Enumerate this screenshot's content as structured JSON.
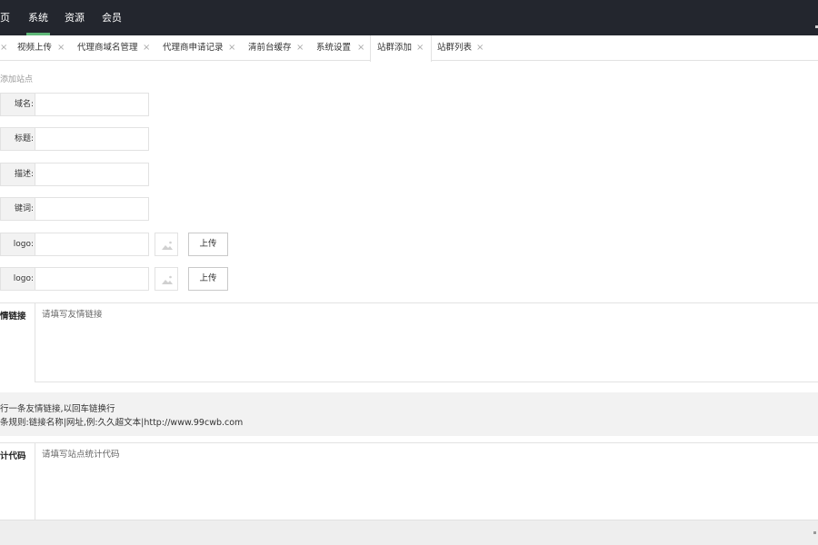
{
  "topnav": {
    "items": [
      {
        "label": "页",
        "active": false
      },
      {
        "label": "系统",
        "active": true
      },
      {
        "label": "资源",
        "active": false
      },
      {
        "label": "会员",
        "active": false
      }
    ],
    "active_color": "#5fb878",
    "background": "#23262e"
  },
  "tabs": [
    {
      "label": "视频上传",
      "active": false
    },
    {
      "label": "代理商域名管理",
      "active": false
    },
    {
      "label": "代理商申请记录",
      "active": false
    },
    {
      "label": "清前台缓存",
      "active": false
    },
    {
      "label": "系统设置",
      "active": false
    },
    {
      "label": "站群添加",
      "active": true
    },
    {
      "label": "站群列表",
      "active": false
    }
  ],
  "tab_close_glyph": "×",
  "form": {
    "legend": "添加站点",
    "fields": [
      {
        "label": "域名:",
        "value": ""
      },
      {
        "label": "标题:",
        "value": ""
      },
      {
        "label": "描述:",
        "value": ""
      },
      {
        "label": "键词:",
        "value": ""
      },
      {
        "label": "logo:",
        "value": "",
        "upload_label": "上传",
        "icon": "image-icon"
      },
      {
        "label": "logo:",
        "value": "",
        "upload_label": "上传",
        "icon": "image-icon"
      }
    ],
    "links": {
      "label": "情链接",
      "placeholder": "请填写友情链接"
    },
    "tips": [
      "行一条友情链接,以回车链换行",
      "条规则:链接名称|网址,例:久久超文本|http://www.99cwb.com"
    ],
    "stats": {
      "label": "计代码",
      "placeholder": "请填写站点统计代码"
    }
  }
}
